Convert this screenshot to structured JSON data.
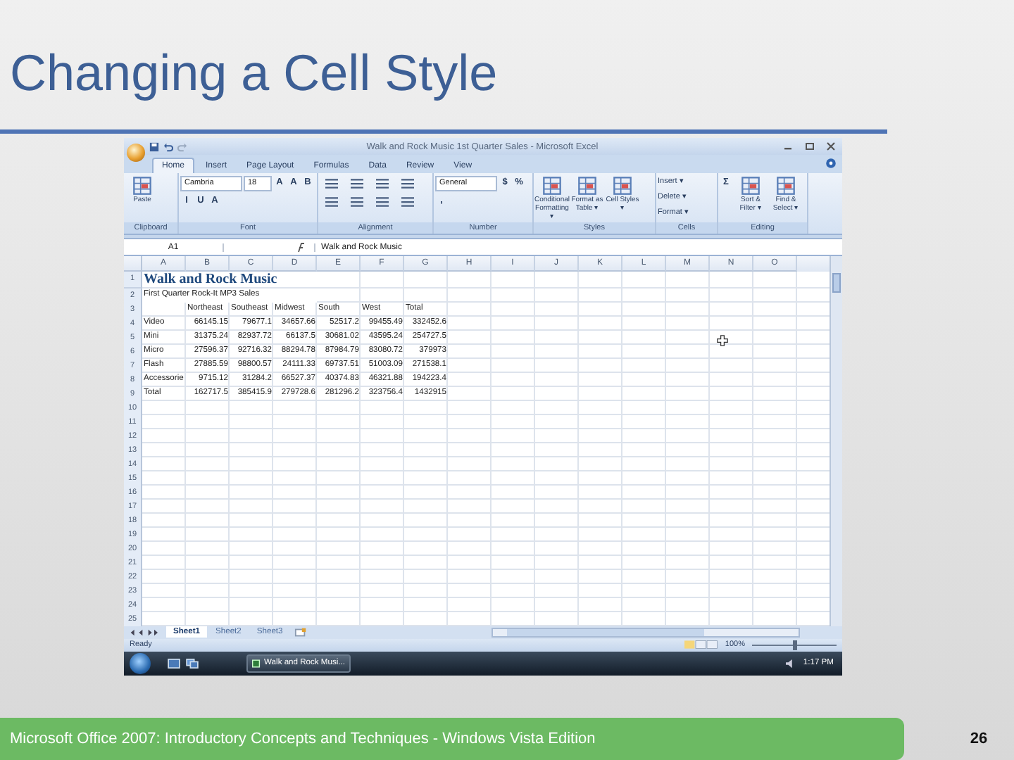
{
  "slide": {
    "title": "Changing a Cell Style",
    "footer": "Microsoft Office 2007: Introductory Concepts and Techniques - Windows Vista Edition",
    "page_number": "26"
  },
  "excel": {
    "window_title": "Walk and Rock Music 1st Quarter Sales - Microsoft Excel",
    "tabs": [
      {
        "label": "Home",
        "selected": true
      },
      {
        "label": "Insert",
        "selected": false
      },
      {
        "label": "Page Layout",
        "selected": false
      },
      {
        "label": "Formulas",
        "selected": false
      },
      {
        "label": "Data",
        "selected": false
      },
      {
        "label": "Review",
        "selected": false
      },
      {
        "label": "View",
        "selected": false
      }
    ],
    "ribbon": [
      {
        "label": "Clipboard",
        "commands": [
          {
            "kind": "large",
            "label": "Paste"
          }
        ]
      },
      {
        "label": "Font",
        "commands": [
          {
            "kind": "combo",
            "label": "Cambria"
          },
          {
            "kind": "combo",
            "label": "18"
          },
          {
            "kind": "glyph",
            "label": "A"
          },
          {
            "kind": "glyph",
            "label": "A"
          },
          {
            "kind": "glyph",
            "label": "B"
          },
          {
            "kind": "glyph",
            "label": "I"
          },
          {
            "kind": "glyph",
            "label": "U"
          },
          {
            "kind": "glyph",
            "label": "A"
          }
        ]
      },
      {
        "label": "Alignment"
      },
      {
        "label": "Number",
        "commands": [
          {
            "kind": "combo",
            "label": "General"
          },
          {
            "kind": "glyph",
            "label": "$"
          },
          {
            "kind": "glyph",
            "label": "%"
          },
          {
            "kind": "glyph",
            "label": ","
          }
        ]
      },
      {
        "label": "Styles",
        "commands": [
          {
            "kind": "large",
            "label": "Conditional Formatting ▾"
          },
          {
            "kind": "large",
            "label": "Format as Table ▾"
          },
          {
            "kind": "large",
            "label": "Cell Styles ▾"
          }
        ]
      },
      {
        "label": "Cells",
        "commands": [
          {
            "kind": "small",
            "label": "Insert ▾"
          },
          {
            "kind": "small",
            "label": "Delete ▾"
          },
          {
            "kind": "small",
            "label": "Format ▾"
          }
        ]
      },
      {
        "label": "Editing",
        "commands": [
          {
            "kind": "glyph",
            "label": "Σ"
          },
          {
            "kind": "large",
            "label": "Sort & Filter ▾"
          },
          {
            "kind": "large",
            "label": "Find & Select ▾"
          }
        ]
      }
    ],
    "name_box": "A1",
    "formula": "Walk and Rock Music",
    "columns": [
      "A",
      "B",
      "C",
      "D",
      "E",
      "F",
      "G",
      "H",
      "I",
      "J",
      "K",
      "L",
      "M",
      "N",
      "O"
    ],
    "rows": [
      {
        "number": "1",
        "kind": "title",
        "cells": [
          "Walk and Rock Music"
        ]
      },
      {
        "number": "2",
        "kind": "text",
        "cells": [
          "First Quarter Rock-It MP3 Sales"
        ]
      },
      {
        "number": "3",
        "kind": "header",
        "cells": [
          "Northeast",
          "Southeast",
          "Midwest",
          "South",
          "West",
          "Total"
        ]
      },
      {
        "number": "4",
        "kind": "data",
        "cells": [
          "Video",
          "66145.15",
          "79677.1",
          "34657.66",
          "52517.2",
          "99455.49",
          "332452.6"
        ]
      },
      {
        "number": "5",
        "kind": "data",
        "cells": [
          "Mini",
          "31375.24",
          "82937.72",
          "66137.5",
          "30681.02",
          "43595.24",
          "254727.5"
        ]
      },
      {
        "number": "6",
        "kind": "data",
        "cells": [
          "Micro",
          "27596.37",
          "92716.32",
          "88294.78",
          "87984.79",
          "83080.72",
          "379973"
        ]
      },
      {
        "number": "7",
        "kind": "data",
        "cells": [
          "Flash",
          "27885.59",
          "98800.57",
          "24111.33",
          "69737.51",
          "51003.09",
          "271538.1"
        ]
      },
      {
        "number": "8",
        "kind": "data",
        "cells": [
          "Accessorie",
          "9715.12",
          "31284.2",
          "66527.37",
          "40374.83",
          "46321.88",
          "194223.4"
        ]
      },
      {
        "number": "9",
        "kind": "data",
        "cells": [
          "Total",
          "162717.5",
          "385415.9",
          "279728.6",
          "281296.2",
          "323756.4",
          "1432915"
        ]
      },
      {
        "number": "10",
        "kind": "empty"
      },
      {
        "number": "11",
        "kind": "empty"
      },
      {
        "number": "12",
        "kind": "empty"
      },
      {
        "number": "13",
        "kind": "empty"
      },
      {
        "number": "14",
        "kind": "empty"
      },
      {
        "number": "15",
        "kind": "empty"
      },
      {
        "number": "16",
        "kind": "empty"
      },
      {
        "number": "17",
        "kind": "empty"
      },
      {
        "number": "18",
        "kind": "empty"
      },
      {
        "number": "19",
        "kind": "empty"
      },
      {
        "number": "20",
        "kind": "empty"
      },
      {
        "number": "21",
        "kind": "empty"
      },
      {
        "number": "22",
        "kind": "empty"
      },
      {
        "number": "23",
        "kind": "empty"
      },
      {
        "number": "24",
        "kind": "empty"
      },
      {
        "number": "25",
        "kind": "empty"
      }
    ],
    "sheet_tabs": [
      {
        "label": "Sheet1",
        "selected": true
      },
      {
        "label": "Sheet2",
        "selected": false
      },
      {
        "label": "Sheet3",
        "selected": false
      }
    ],
    "status": "Ready",
    "zoom": {
      "reading": "100%",
      "level": 0.5
    },
    "taskbar": {
      "window_button": "Walk and Rock Musi...",
      "clock": "1:17 PM"
    }
  }
}
